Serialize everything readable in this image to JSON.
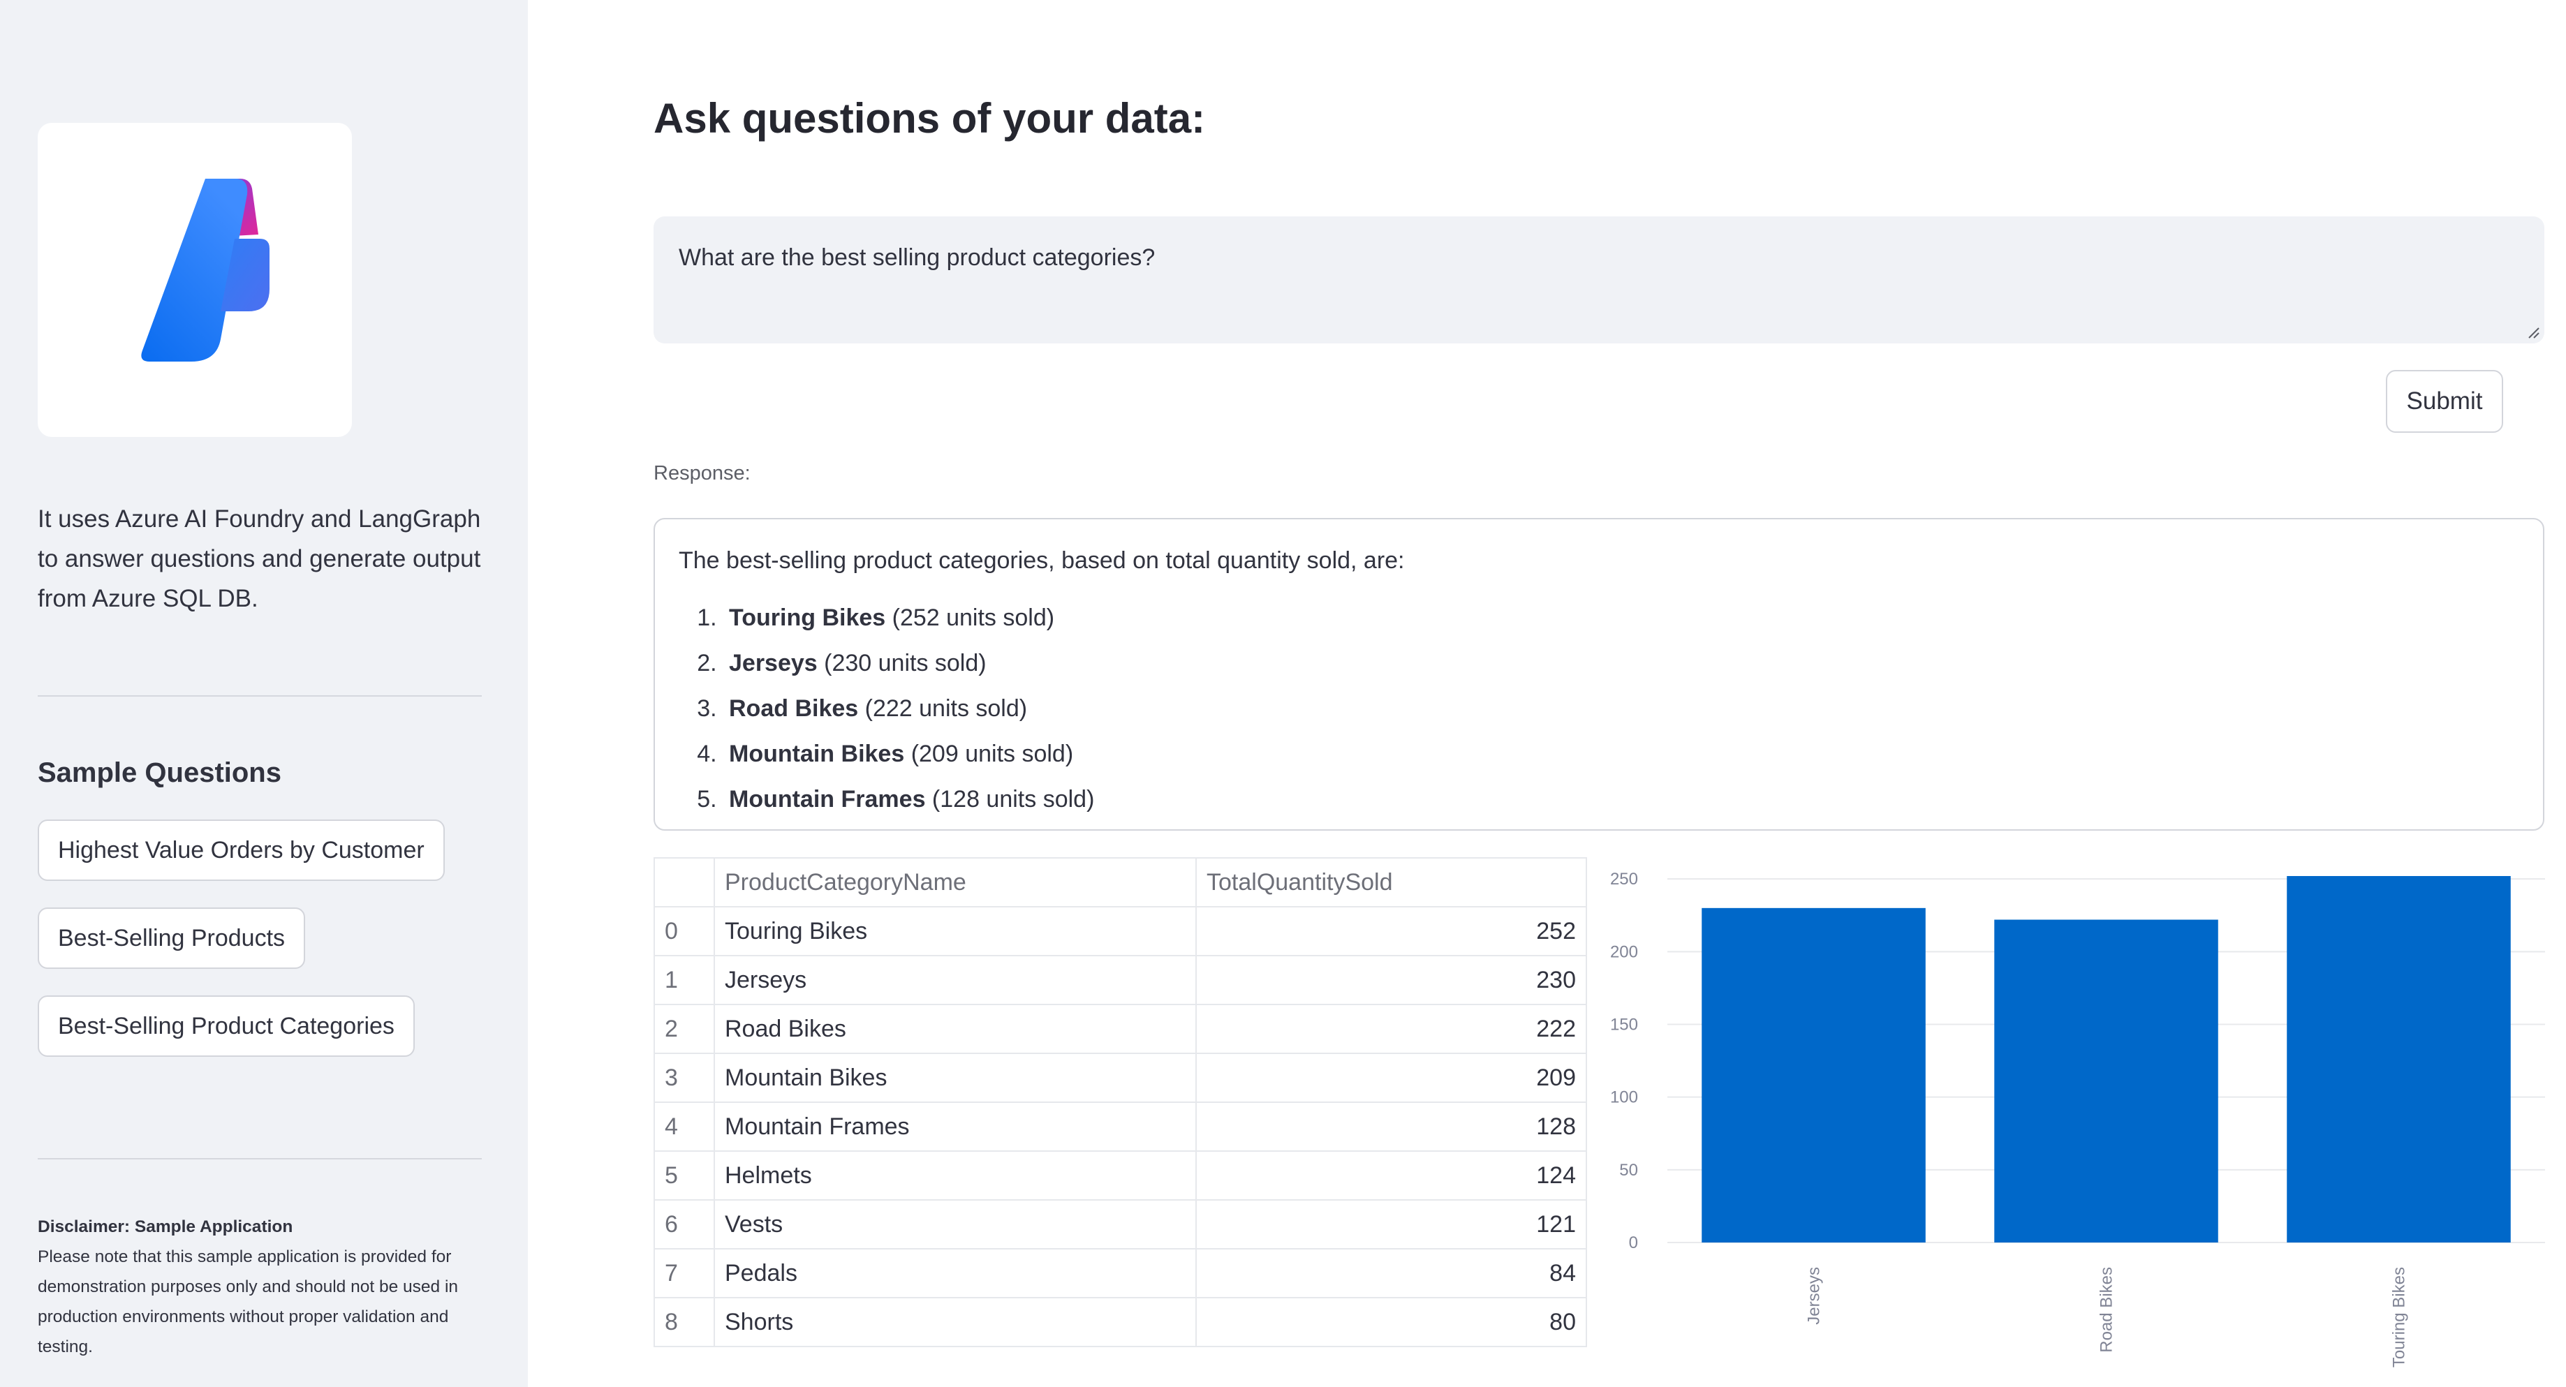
{
  "sidebar": {
    "logo_icon": "azure-ai-foundry-logo",
    "intro_text": "It uses Azure AI Foundry and LangGraph to answer questions and generate output from Azure SQL DB.",
    "sample_heading": "Sample Questions",
    "sample_buttons": [
      "Highest Value Orders by Customer",
      "Best-Selling Products",
      "Best-Selling Product Categories"
    ],
    "disclaimer_title": "Disclaimer: Sample Application",
    "disclaimer_text": "Please note that this sample application is provided for demonstration purposes only and should not be used in production environments without proper validation and testing."
  },
  "main": {
    "title": "Ask questions of your data:",
    "query_value": "What are the best selling product categories?",
    "submit_label": "Submit",
    "response_label": "Response:",
    "response_intro": "The best-selling product categories, based on total quantity sold, are:",
    "response_items": [
      {
        "number": "1.",
        "name": "Touring Bikes",
        "detail": " (252 units sold)"
      },
      {
        "number": "2.",
        "name": "Jerseys",
        "detail": " (230 units sold)"
      },
      {
        "number": "3.",
        "name": "Road Bikes",
        "detail": " (222 units sold)"
      },
      {
        "number": "4.",
        "name": "Mountain Bikes",
        "detail": " (209 units sold)"
      },
      {
        "number": "5.",
        "name": "Mountain Frames",
        "detail": " (128 units sold)"
      }
    ]
  },
  "table": {
    "columns": [
      "",
      "ProductCategoryName",
      "TotalQuantitySold"
    ],
    "rows": [
      [
        "0",
        "Touring Bikes",
        "252"
      ],
      [
        "1",
        "Jerseys",
        "230"
      ],
      [
        "2",
        "Road Bikes",
        "222"
      ],
      [
        "3",
        "Mountain Bikes",
        "209"
      ],
      [
        "4",
        "Mountain Frames",
        "128"
      ],
      [
        "5",
        "Helmets",
        "124"
      ],
      [
        "6",
        "Vests",
        "121"
      ],
      [
        "7",
        "Pedals",
        "84"
      ],
      [
        "8",
        "Shorts",
        "80"
      ]
    ]
  },
  "chart_data": {
    "type": "bar",
    "categories": [
      "Jerseys",
      "Road Bikes",
      "Touring Bikes"
    ],
    "values": [
      230,
      222,
      252
    ],
    "ylim": [
      0,
      252
    ],
    "yticks": [
      0,
      50,
      100,
      150,
      200,
      250
    ],
    "grid": true,
    "bar_color": "#0068c9",
    "xlabel": "",
    "ylabel": "",
    "title": ""
  }
}
